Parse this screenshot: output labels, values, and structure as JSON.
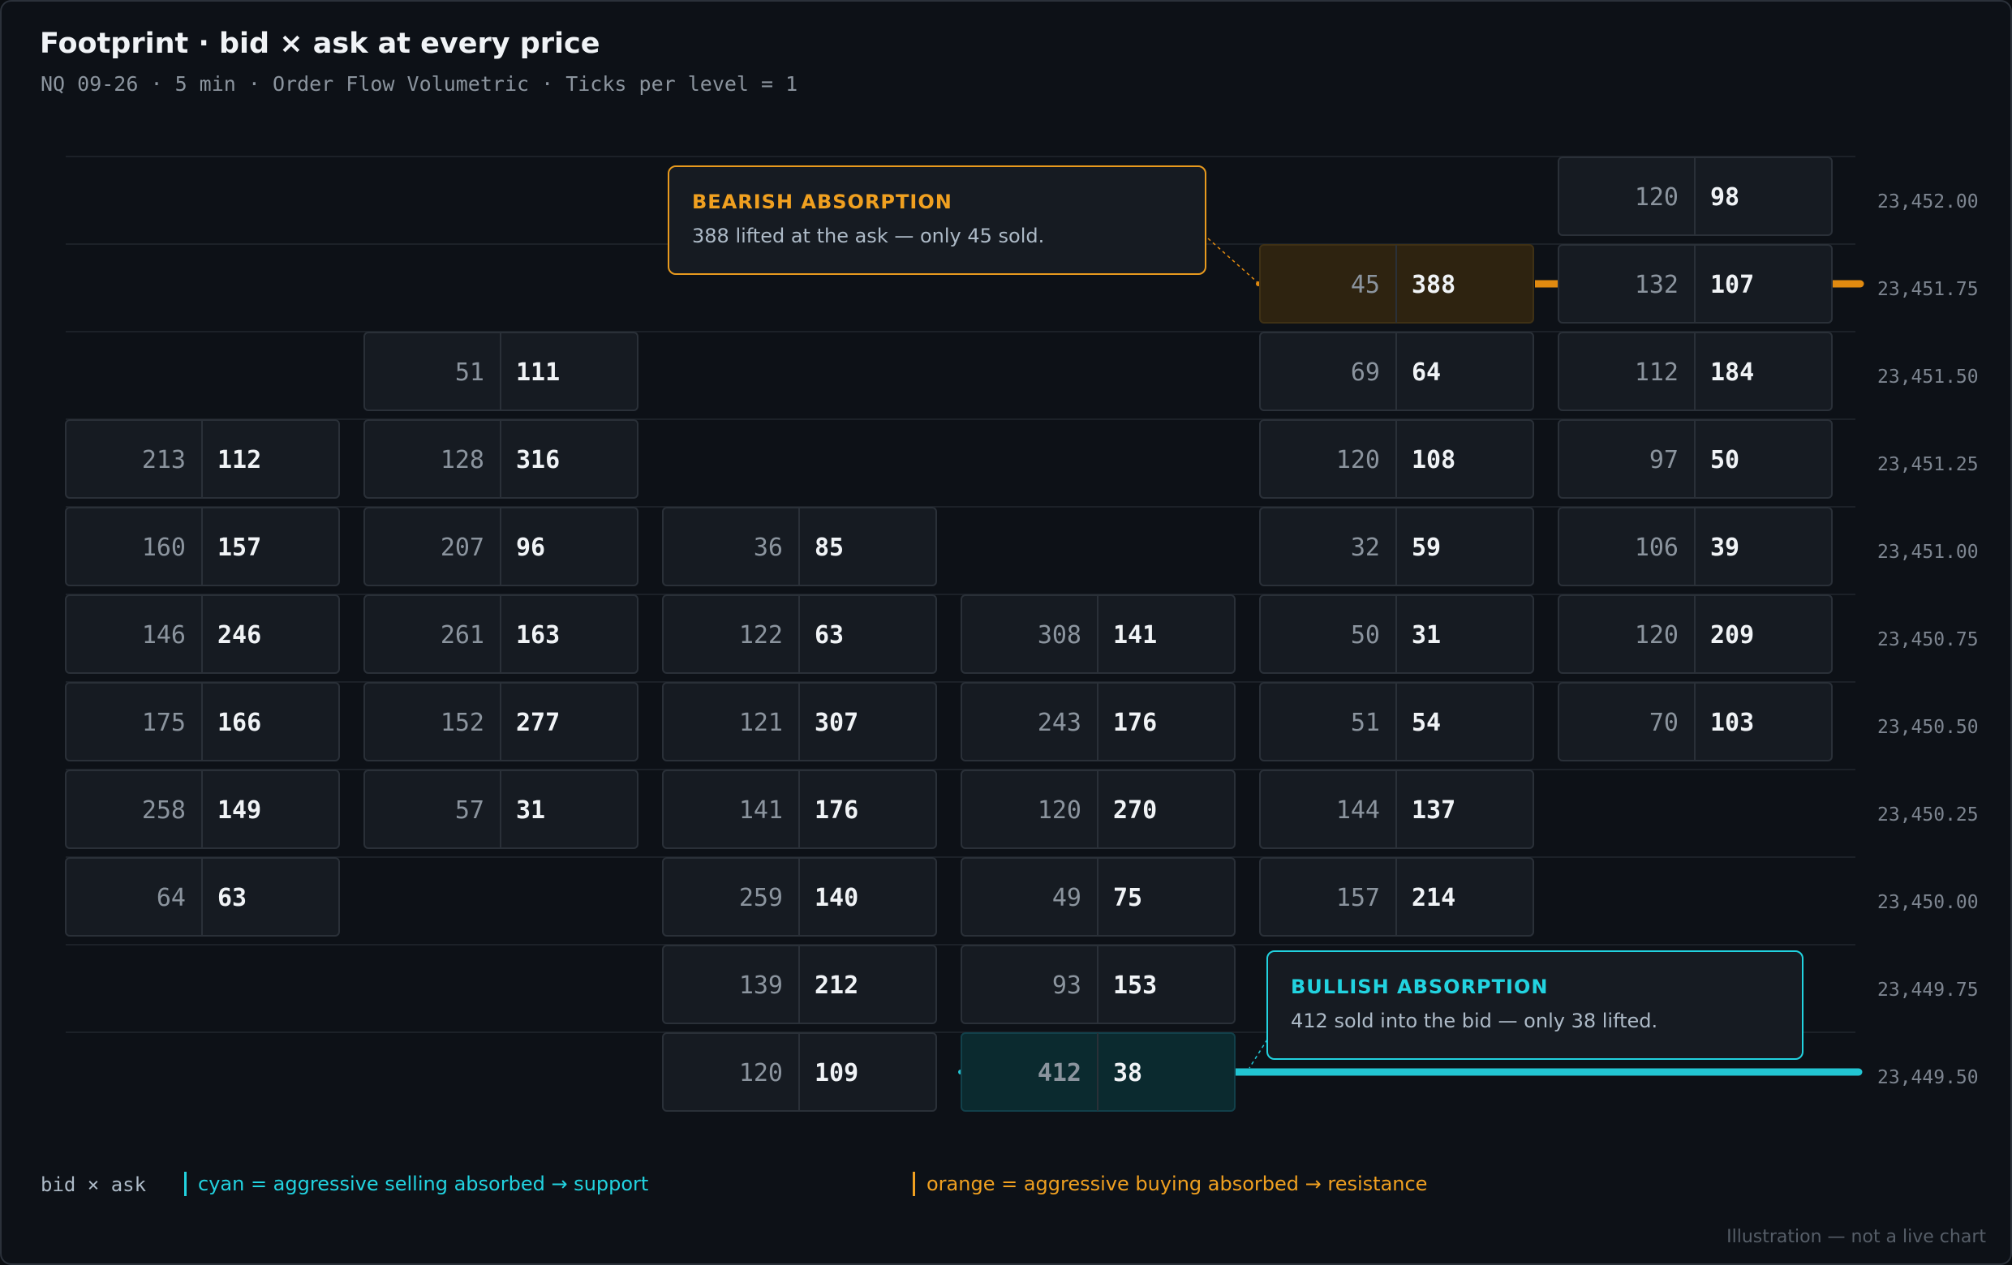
{
  "header": {
    "title": "Footprint · bid × ask at every price",
    "subtitle": "NQ 09-26 · 5 min · Order Flow Volumetric · Ticks per level = 1"
  },
  "chart_data": {
    "type": "table",
    "title": "Footprint · bid × ask at every price",
    "subtitle": "NQ 09-26 · 5 min · Order Flow Volumetric · Ticks per level = 1",
    "cell_format": "bid × ask",
    "price_levels": [
      "23,452.00",
      "23,451.75",
      "23,451.50",
      "23,451.25",
      "23,451.00",
      "23,450.75",
      "23,450.50",
      "23,450.25",
      "23,450.00",
      "23,449.75",
      "23,449.50"
    ],
    "bars": [
      {
        "levels": [
          {
            "price": "23,451.25",
            "bid": 213,
            "ask": 112
          },
          {
            "price": "23,451.00",
            "bid": 160,
            "ask": 157
          },
          {
            "price": "23,450.75",
            "bid": 146,
            "ask": 246
          },
          {
            "price": "23,450.50",
            "bid": 175,
            "ask": 166
          },
          {
            "price": "23,450.25",
            "bid": 258,
            "ask": 149
          },
          {
            "price": "23,450.00",
            "bid": 64,
            "ask": 63
          }
        ]
      },
      {
        "levels": [
          {
            "price": "23,451.50",
            "bid": 51,
            "ask": 111
          },
          {
            "price": "23,451.25",
            "bid": 128,
            "ask": 316
          },
          {
            "price": "23,451.00",
            "bid": 207,
            "ask": 96
          },
          {
            "price": "23,450.75",
            "bid": 261,
            "ask": 163
          },
          {
            "price": "23,450.50",
            "bid": 152,
            "ask": 277
          },
          {
            "price": "23,450.25",
            "bid": 57,
            "ask": 31
          }
        ]
      },
      {
        "levels": [
          {
            "price": "23,451.00",
            "bid": 36,
            "ask": 85
          },
          {
            "price": "23,450.75",
            "bid": 122,
            "ask": 63
          },
          {
            "price": "23,450.50",
            "bid": 121,
            "ask": 307
          },
          {
            "price": "23,450.25",
            "bid": 141,
            "ask": 176
          },
          {
            "price": "23,450.00",
            "bid": 259,
            "ask": 140
          },
          {
            "price": "23,449.75",
            "bid": 139,
            "ask": 212
          },
          {
            "price": "23,449.50",
            "bid": 120,
            "ask": 109
          }
        ]
      },
      {
        "levels": [
          {
            "price": "23,450.75",
            "bid": 308,
            "ask": 141
          },
          {
            "price": "23,450.50",
            "bid": 243,
            "ask": 176
          },
          {
            "price": "23,450.25",
            "bid": 120,
            "ask": 270
          },
          {
            "price": "23,450.00",
            "bid": 49,
            "ask": 75
          },
          {
            "price": "23,449.75",
            "bid": 93,
            "ask": 153
          },
          {
            "price": "23,449.50",
            "bid": 412,
            "ask": 38,
            "highlight": "bullish"
          }
        ]
      },
      {
        "levels": [
          {
            "price": "23,451.75",
            "bid": 45,
            "ask": 388,
            "highlight": "bearish"
          },
          {
            "price": "23,451.50",
            "bid": 69,
            "ask": 64
          },
          {
            "price": "23,451.25",
            "bid": 120,
            "ask": 108
          },
          {
            "price": "23,451.00",
            "bid": 32,
            "ask": 59
          },
          {
            "price": "23,450.75",
            "bid": 50,
            "ask": 31
          },
          {
            "price": "23,450.50",
            "bid": 51,
            "ask": 54
          },
          {
            "price": "23,450.25",
            "bid": 144,
            "ask": 137
          },
          {
            "price": "23,450.00",
            "bid": 157,
            "ask": 214
          }
        ]
      },
      {
        "levels": [
          {
            "price": "23,452.00",
            "bid": 120,
            "ask": 98
          },
          {
            "price": "23,451.75",
            "bid": 132,
            "ask": 107
          },
          {
            "price": "23,451.50",
            "bid": 112,
            "ask": 184
          },
          {
            "price": "23,451.25",
            "bid": 97,
            "ask": 50
          },
          {
            "price": "23,451.00",
            "bid": 106,
            "ask": 39
          },
          {
            "price": "23,450.75",
            "bid": 120,
            "ask": 209
          },
          {
            "price": "23,450.50",
            "bid": 70,
            "ask": 103
          }
        ]
      }
    ],
    "levels_marked": [
      {
        "price": "23,451.75",
        "kind": "resistance",
        "color": "#e08a10"
      },
      {
        "price": "23,449.50",
        "kind": "support",
        "color": "#22c5d3"
      }
    ],
    "grid": true
  },
  "callouts": {
    "bearish": {
      "title": "BEARISH ABSORPTION",
      "body": "388 lifted at the ask — only 45 sold."
    },
    "bullish": {
      "title": "BULLISH ABSORPTION",
      "body": "412 sold into the bid — only 38 lifted."
    }
  },
  "legend": {
    "label": "bid × ask",
    "cyan": "cyan = aggressive selling absorbed → support",
    "orange": "orange = aggressive buying absorbed → resistance"
  },
  "footnote": "Illustration — not a live chart",
  "colors": {
    "background": "#0d1117",
    "bullish": "#22d3e0",
    "bearish": "#f0a020",
    "bid_text": "#8b949e",
    "ask_text": "#f0f3f6"
  }
}
